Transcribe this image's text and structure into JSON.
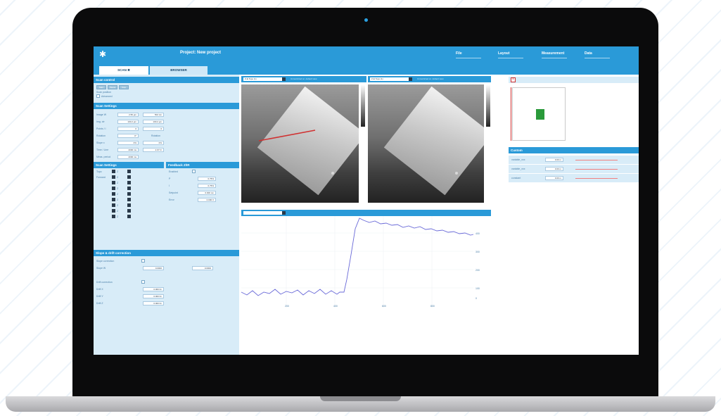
{
  "app": {
    "logo": "✱",
    "project_title": "Project: New project",
    "menu": [
      "File",
      "Layout",
      "Measurement",
      "Data"
    ]
  },
  "tabs": [
    {
      "label": "SCAN ✖",
      "active": true
    },
    {
      "label": "BROWSER",
      "active": false
    }
  ],
  "scan_control": {
    "title": "Scan control",
    "buttons": [
      "Start",
      "Pause",
      "Stop"
    ],
    "scan_position_label": "Scan position",
    "advanced_label": "Advanced"
  },
  "scan_settings": {
    "title": "Scan Settings",
    "rows": [
      {
        "label": "Image W",
        "v1": "2.56 µm",
        "v2": "504 nm"
      },
      {
        "label": "Img. ctr",
        "v1": "100.2 µm",
        "v2": "100.2 µm"
      },
      {
        "label": "Points / l",
        "v1": "0",
        "v2": "0"
      },
      {
        "label": "Rotation",
        "v1": "0°",
        "v2": "Rotation"
      },
      {
        "label": "Slope x",
        "v1": "0%",
        "v2": "0%"
      },
      {
        "label": "Time / Line",
        "v1": "2000 ms",
        "v2": "2.97 hr"
      },
      {
        "label": "Meas. period",
        "v1": "2000 ms",
        "v2": ""
      }
    ]
  },
  "scan_settings_2": {
    "title": "Scan Settings",
    "rows": [
      {
        "label": "Topo",
        "v": "Z"
      },
      {
        "label": "Forward",
        "v": "Z"
      },
      {
        "label": "",
        "v": "Z"
      },
      {
        "label": "",
        "v": "Z"
      },
      {
        "label": "",
        "v": "Z"
      },
      {
        "label": "",
        "v": "Z"
      },
      {
        "label": "",
        "v": "Z"
      },
      {
        "label": "",
        "v": "Z"
      },
      {
        "label": "",
        "v": "Z"
      }
    ]
  },
  "feedback": {
    "title": "Feedback Z/IR",
    "rows": [
      {
        "label": "Enabled",
        "v": ""
      },
      {
        "label": "P",
        "v": "0.75%"
      },
      {
        "label": "I",
        "v": "0.75%"
      },
      {
        "label": "Setpoint",
        "v": "0.000 nm"
      },
      {
        "label": "Error",
        "v": "0.000 V"
      }
    ]
  },
  "slope": {
    "title": "Slope & drift correction",
    "rows": [
      {
        "label": "Slope correction",
        "v1": "",
        "v2": ""
      },
      {
        "label": "Slope W",
        "v1": "0.0000",
        "v2": "0.0000"
      },
      {
        "label": "Drift correction",
        "v1": "",
        "v2": ""
      },
      {
        "label": "Drift X",
        "v1": "0.000 fm",
        "v2": ""
      },
      {
        "label": "Drift Y",
        "v1": "0.000 fm",
        "v2": ""
      },
      {
        "label": "Drift Z",
        "v1": "0.000 fm",
        "v2": ""
      }
    ]
  },
  "image_panels": [
    {
      "select": "Z-E Topo (1)",
      "note": "Unrestricted sc. default view"
    },
    {
      "select": "Z-E Topo (1)",
      "note": "Unrestricted sc. default view"
    }
  ],
  "graph": {
    "select": "",
    "x_ticks": [
      "200",
      "400",
      "600",
      "800"
    ],
    "y_ticks": [
      "400",
      "300",
      "200",
      "100",
      "0"
    ]
  },
  "right": {
    "custom_title": "Custom",
    "rows": [
      {
        "label": "variable_xxx",
        "v": "0.00 m"
      },
      {
        "label": "variable_xxx",
        "v": "0.00 m"
      },
      {
        "label": "constant",
        "v": "0.00 m"
      }
    ]
  },
  "colors": {
    "accent": "#2a9ad8",
    "panel": "#d8ecf8",
    "trace": "#6a6ad8",
    "scan_line": "#d03030",
    "marker": "#2a9a3a"
  }
}
